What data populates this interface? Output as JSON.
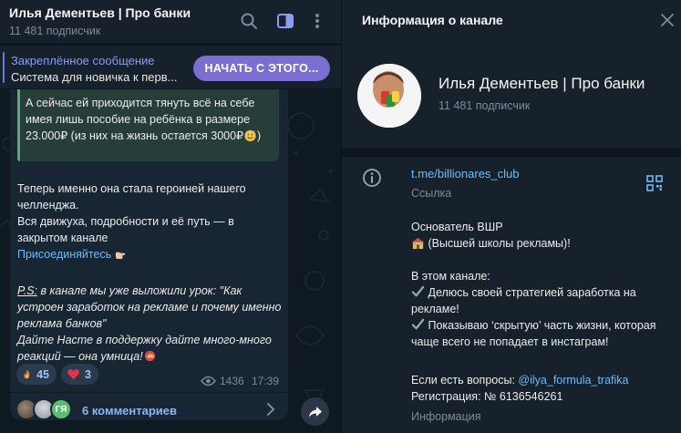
{
  "chat": {
    "title": "Илья Дементьев | Про банки",
    "subscribers": "11 481 подписчик",
    "pinned": {
      "label": "Закреплённое сообщение",
      "text": "Система для новичка к перв...",
      "button": "НАЧАТЬ С ЭТОГО..."
    },
    "message": {
      "quote": "А сейчас ей приходится тянуть всё на себе имея лишь пособие на ребёнка в размере 23.000₽ (из них на жизнь остается 3000₽",
      "quote_end": ")",
      "p1_line1": "Теперь именно она стала героиней нашего",
      "p1_line2": "челленджа.",
      "p1_line3": "Вся движуха, подробности и её путь — в закрытом канале",
      "p1_link": "Присоединяйтесь",
      "p2_prefix": "P.S:",
      "p2_text": " в канале мы уже выложили урок: \"Как устроен заработок на рекламе и почему именно реклама банков\"",
      "p2_line2": "Дайте Насте в поддержку дайте много-много реакций — она умница!",
      "reactions": [
        {
          "emoji": "fire",
          "count": "45"
        },
        {
          "emoji": "heart",
          "count": "3"
        }
      ],
      "views": "1436",
      "time": "17:39",
      "avatar3_initials": "ГЯ",
      "comments": "6 комментариев"
    }
  },
  "info": {
    "header": "Информация о канале",
    "channel_name": "Илья Дементьев | Про банки",
    "subscribers": "11 481 подписчик",
    "link": "t.me/billionares_club",
    "link_label": "Ссылка",
    "desc_founder": "Основатель ВШР",
    "desc_school": " (Высшей школы рекламы)!",
    "desc_in_channel": "В этом канале:",
    "desc_b1": " Делюсь своей стратегией заработка на рекламе!",
    "desc_b2": " Показываю ‘скрытую’ часть жизни, которая чаще всего не попадает в инстаграм!",
    "desc_questions": "Если есть вопросы: ",
    "desc_questions_link": "@ilya_formula_trafika",
    "desc_reg": "Регистрация: № 6136546261",
    "desc_label": "Информация"
  },
  "colors": {
    "accent": "#7b6ed1",
    "link": "#71baf5",
    "panel": "#17212b",
    "background": "#0e1621"
  }
}
